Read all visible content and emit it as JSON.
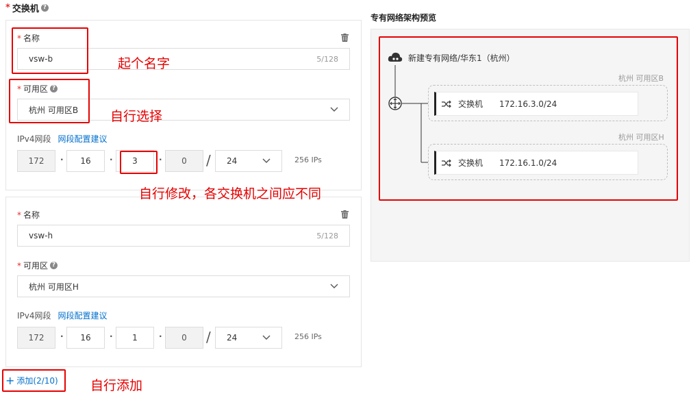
{
  "section": {
    "title": "交换机",
    "required_mark": "*"
  },
  "switches": [
    {
      "name_label": "名称",
      "name_value": "vsw-b",
      "name_count": "5/128",
      "zone_label": "可用区",
      "zone_value": "杭州 可用区B",
      "ipv4_label": "IPv4网段",
      "ipv4_link": "网段配置建议",
      "octets": [
        "172",
        "16",
        "3",
        "0"
      ],
      "mask": "24",
      "ip_count": "256 IPs"
    },
    {
      "name_label": "名称",
      "name_value": "vsw-h",
      "name_count": "5/128",
      "zone_label": "可用区",
      "zone_value": "杭州 可用区H",
      "ipv4_label": "IPv4网段",
      "ipv4_link": "网段配置建议",
      "octets": [
        "172",
        "16",
        "1",
        "0"
      ],
      "mask": "24",
      "ip_count": "256 IPs"
    }
  ],
  "add_button": {
    "label": "添加(2/10)"
  },
  "preview": {
    "title": "专有网络架构预览",
    "vpc_label": "新建专有网络/华东1（杭州）",
    "zones": [
      {
        "label": "杭州 可用区B",
        "switch_label": "交换机",
        "cidr": "172.16.3.0/24"
      },
      {
        "label": "杭州 可用区H",
        "switch_label": "交换机",
        "cidr": "172.16.1.0/24"
      }
    ]
  },
  "annotations": {
    "name_note": "起个名字",
    "zone_note": "自行选择",
    "octet_note": "自行修改，各交换机之间应不同",
    "add_note": "自行添加"
  },
  "colors": {
    "accent": "#0070cc",
    "annotation": "#e60000",
    "required": "#e62e2e"
  },
  "icons": [
    "help-icon",
    "trash-icon",
    "chevron-down-icon",
    "plus-icon",
    "cloud-icon",
    "router-icon",
    "switch-icon"
  ]
}
